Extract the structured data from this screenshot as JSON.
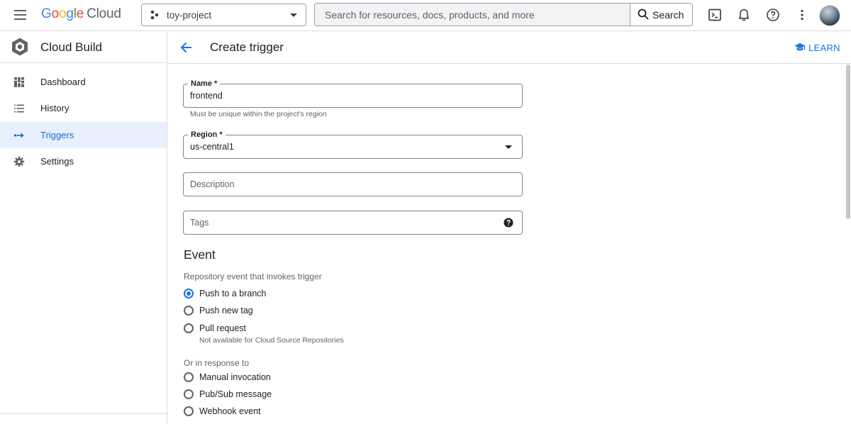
{
  "topbar": {
    "logo": {
      "g": "G",
      "o1": "o",
      "o2": "o",
      "g2": "g",
      "l": "l",
      "e": "e",
      "cloud": "Cloud"
    },
    "project": "toy-project",
    "search_placeholder": "Search for resources, docs, products, and more",
    "search_button": "Search",
    "icons": [
      "menu-icon",
      "project-icon",
      "search-icon",
      "cloud-shell-icon",
      "notifications-icon",
      "help-icon",
      "more-vert-icon",
      "avatar"
    ]
  },
  "sidebar": {
    "product": "Cloud Build",
    "items": [
      {
        "label": "Dashboard",
        "icon": "dashboard-icon",
        "active": false
      },
      {
        "label": "History",
        "icon": "history-list-icon",
        "active": false
      },
      {
        "label": "Triggers",
        "icon": "triggers-icon",
        "active": true
      },
      {
        "label": "Settings",
        "icon": "gear-icon",
        "active": false
      }
    ]
  },
  "page": {
    "title": "Create trigger",
    "learn": "LEARN"
  },
  "form": {
    "name": {
      "label": "Name *",
      "value": "frontend",
      "helper": "Must be unique within the project's region"
    },
    "region": {
      "label": "Region *",
      "value": "us-central1"
    },
    "description": {
      "placeholder": "Description"
    },
    "tags": {
      "placeholder": "Tags"
    }
  },
  "event": {
    "title": "Event",
    "repo_subhead": "Repository event that invokes trigger",
    "repo_options": [
      {
        "label": "Push to a branch",
        "checked": true
      },
      {
        "label": "Push new tag",
        "checked": false
      },
      {
        "label": "Pull request",
        "checked": false,
        "note": "Not available for Cloud Source Repositories"
      }
    ],
    "response_subhead": "Or in response to",
    "response_options": [
      {
        "label": "Manual invocation",
        "checked": false
      },
      {
        "label": "Pub/Sub message",
        "checked": false
      },
      {
        "label": "Webhook event",
        "checked": false
      }
    ]
  },
  "colors": {
    "accent": "#1a73e8",
    "active_nav_bg": "#e8f0fe",
    "border": "#dadce0",
    "text": "#202124",
    "secondary_text": "#5f6368"
  }
}
